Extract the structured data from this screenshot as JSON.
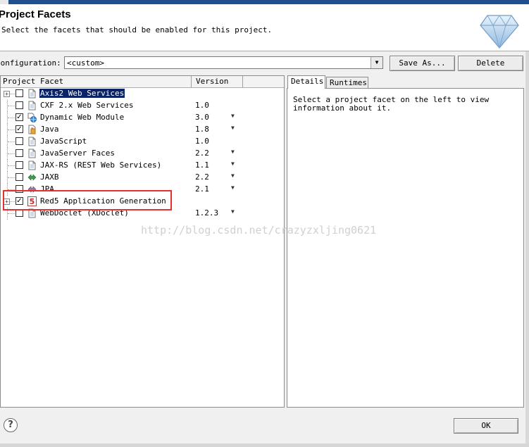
{
  "header": {
    "title": "Project Facets",
    "description": "Select the facets that should be enabled for this project."
  },
  "configuration": {
    "label": "Configuration:",
    "value": "<custom>",
    "save_as_label": "Save As...",
    "delete_label": "Delete"
  },
  "table": {
    "col_facet": "Project Facet",
    "col_version": "Version",
    "rows": [
      {
        "name": "Axis2 Web Services",
        "version": "",
        "checked": false,
        "expandable": true,
        "selected": true,
        "icon": "folder-doc-icon",
        "dropdown": false
      },
      {
        "name": "CXF 2.x Web Services",
        "version": "1.0",
        "checked": false,
        "expandable": false,
        "selected": false,
        "icon": "doc-icon",
        "dropdown": false
      },
      {
        "name": "Dynamic Web Module",
        "version": "3.0",
        "checked": true,
        "expandable": false,
        "selected": false,
        "icon": "web-module-icon",
        "dropdown": true
      },
      {
        "name": "Java",
        "version": "1.8",
        "checked": true,
        "expandable": false,
        "selected": false,
        "icon": "java-icon",
        "dropdown": true
      },
      {
        "name": "JavaScript",
        "version": "1.0",
        "checked": false,
        "expandable": false,
        "selected": false,
        "icon": "doc-icon",
        "dropdown": false
      },
      {
        "name": "JavaServer Faces",
        "version": "2.2",
        "checked": false,
        "expandable": false,
        "selected": false,
        "icon": "doc-icon",
        "dropdown": true
      },
      {
        "name": "JAX-RS (REST Web Services)",
        "version": "1.1",
        "checked": false,
        "expandable": false,
        "selected": false,
        "icon": "doc-icon",
        "dropdown": true
      },
      {
        "name": "JAXB",
        "version": "2.2",
        "checked": false,
        "expandable": false,
        "selected": false,
        "icon": "jaxb-icon",
        "dropdown": true
      },
      {
        "name": "JPA",
        "version": "2.1",
        "checked": false,
        "expandable": false,
        "selected": false,
        "icon": "jpa-icon",
        "dropdown": true
      },
      {
        "name": "Red5 Application Generation",
        "version": "",
        "checked": true,
        "expandable": true,
        "selected": false,
        "icon": "red5-icon",
        "dropdown": false
      },
      {
        "name": "WebDoclet (XDoclet)",
        "version": "1.2.3",
        "checked": false,
        "expandable": false,
        "selected": false,
        "icon": "doc-icon",
        "dropdown": true
      }
    ]
  },
  "details": {
    "tab_details": "Details",
    "tab_runtimes": "Runtimes",
    "text": "Select a project facet on the left to view information about it."
  },
  "watermark": "http://blog.csdn.net/crazyzxljing0621",
  "footer": {
    "help": "?",
    "ok_label": "OK"
  },
  "colors": {
    "selection": "#0a246a",
    "highlight_box": "#e53030",
    "title_bar": "#1f4f8f"
  }
}
